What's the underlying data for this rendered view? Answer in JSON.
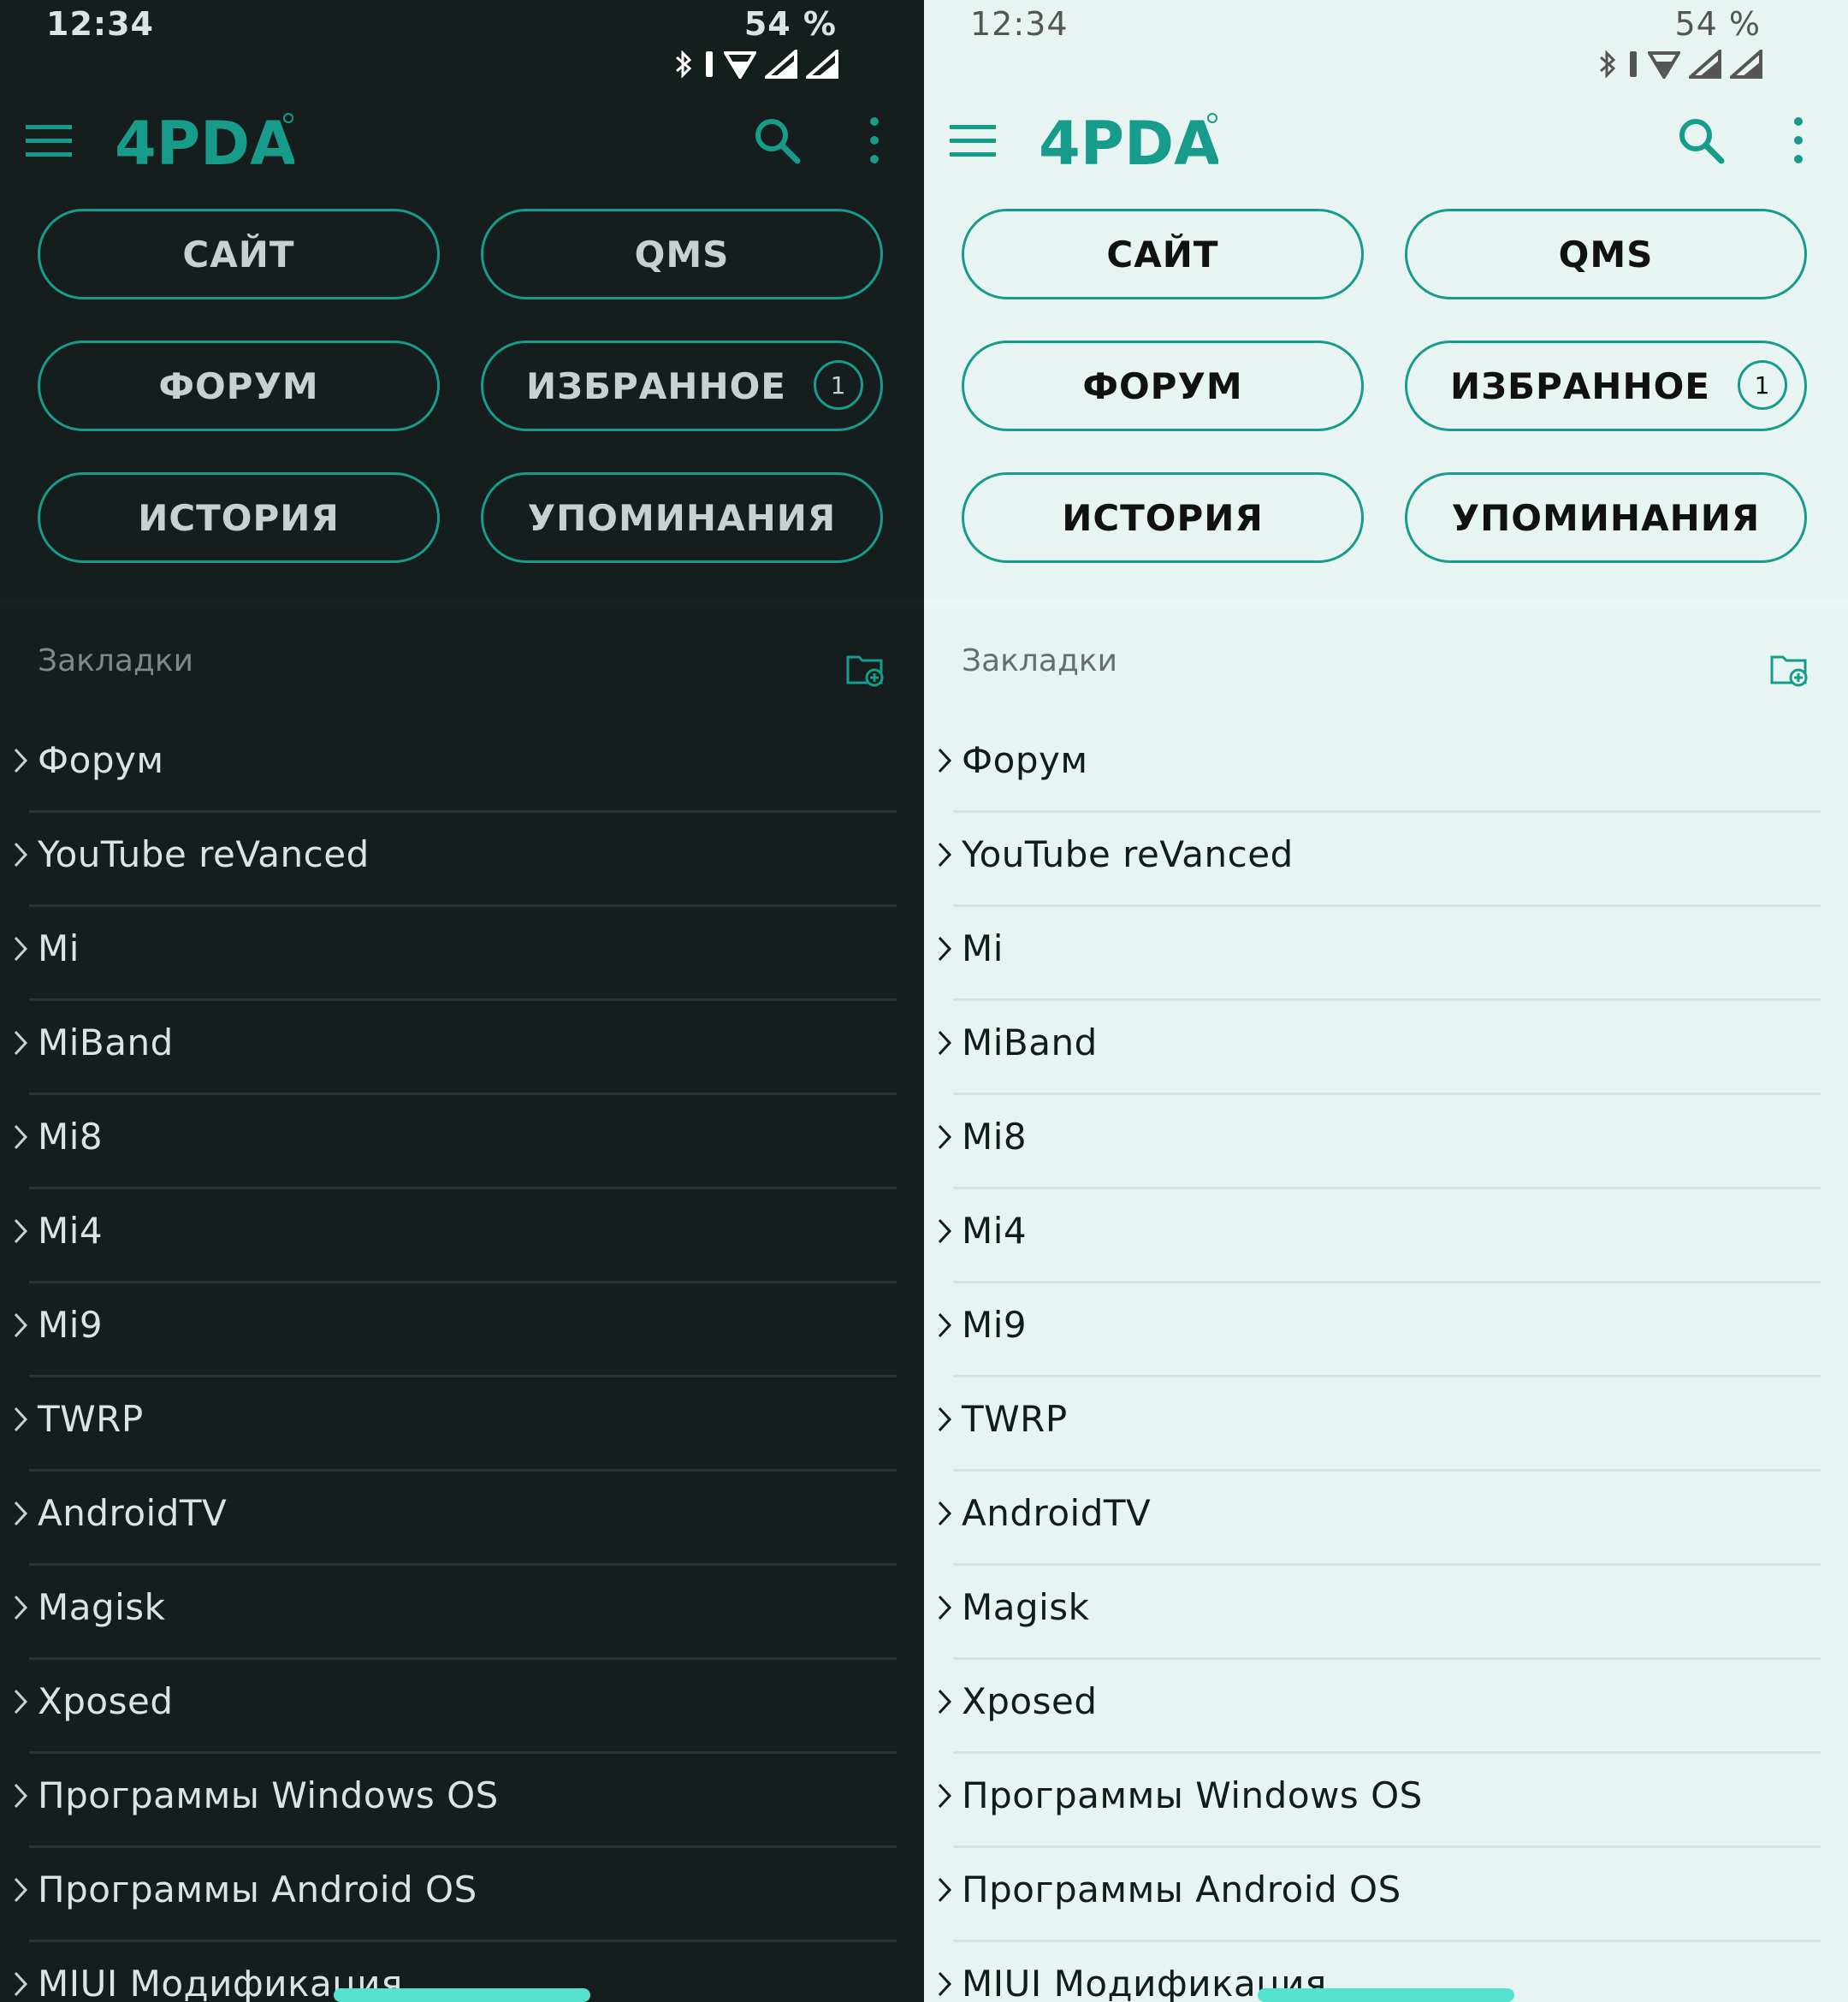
{
  "status_bar": {
    "time": "12:34",
    "battery": "54 %"
  },
  "app": {
    "logo_text": "4PDA"
  },
  "buttons": {
    "site": "САЙТ",
    "qms": "QMS",
    "forum": "ФОРУМ",
    "favorites": "ИЗБРАННОЕ",
    "favorites_badge": "1",
    "history": "ИСТОРИЯ",
    "mentions": "УПОМИНАНИЯ"
  },
  "bookmarks": {
    "title": "Закладки",
    "items": [
      "Форум",
      "YouTube reVanced",
      "Mi",
      "MiBand",
      "Mi8",
      "Mi4",
      "Mi9",
      "TWRP",
      "AndroidTV",
      "Magisk",
      "Xposed",
      "Программы Windows OS",
      "Программы Android OS",
      "MIUI Модификация"
    ]
  },
  "colors": {
    "accent": "#179b8a",
    "dark_bg": "#161d1d",
    "light_bg": "#e7f4f1"
  },
  "icons": [
    "menu-icon",
    "search-icon",
    "more-vert-icon",
    "add-folder-icon",
    "chevron-right-icon"
  ]
}
